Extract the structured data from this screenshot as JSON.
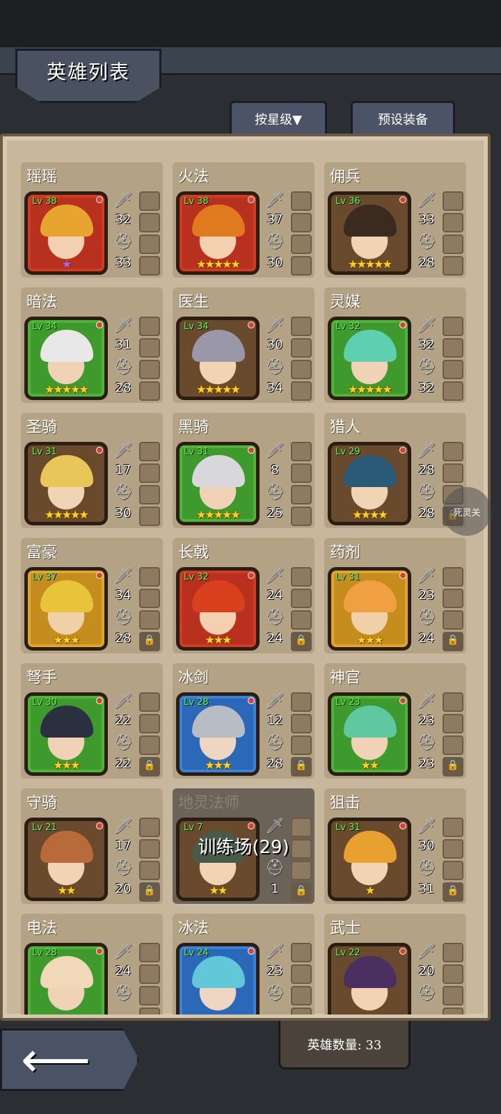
{
  "header": {
    "title": "英雄列表",
    "sort_button": "按星级▼",
    "preset_button": "预设装备"
  },
  "side_float_label": "死灵关",
  "hero_count_label": "英雄数量: 33",
  "heroes": [
    {
      "name": "瑶瑶",
      "level": "Lv 38",
      "frame": "red",
      "hair": "#e7a42e",
      "attack": "32",
      "defense": "33",
      "stars": "★",
      "star_color": "purple",
      "locks": 0,
      "dim": false
    },
    {
      "name": "火法",
      "level": "Lv 38",
      "frame": "red",
      "hair": "#e07a1e",
      "attack": "37",
      "defense": "30",
      "stars": "★★★★★",
      "star_color": "gold",
      "locks": 0,
      "dim": false
    },
    {
      "name": "佣兵",
      "level": "Lv 36",
      "frame": "plain",
      "hair": "#3a2a20",
      "attack": "33",
      "defense": "28",
      "stars": "★★★★★",
      "star_color": "gold",
      "locks": 0,
      "dim": false
    },
    {
      "name": "暗法",
      "level": "Lv 34",
      "frame": "green",
      "hair": "#e8e8e8",
      "attack": "31",
      "defense": "28",
      "stars": "★★★★★",
      "star_color": "gold",
      "locks": 0,
      "dim": false
    },
    {
      "name": "医生",
      "level": "Lv 34",
      "frame": "plain",
      "hair": "#9a98a8",
      "attack": "30",
      "defense": "34",
      "stars": "★★★★★",
      "star_color": "gold",
      "locks": 0,
      "dim": false
    },
    {
      "name": "灵媒",
      "level": "Lv 32",
      "frame": "green",
      "hair": "#5ed0b0",
      "attack": "32",
      "defense": "32",
      "stars": "★★★★★",
      "star_color": "gold",
      "locks": 0,
      "dim": false
    },
    {
      "name": "圣骑",
      "level": "Lv 31",
      "frame": "plain",
      "hair": "#e8c65a",
      "attack": "17",
      "defense": "30",
      "stars": "★★★★★",
      "star_color": "gold",
      "locks": 0,
      "dim": false
    },
    {
      "name": "黑骑",
      "level": "Lv 31",
      "frame": "green",
      "hair": "#d8d8dc",
      "attack": "8",
      "defense": "25",
      "stars": "★★★★★",
      "star_color": "gold",
      "locks": 0,
      "dim": false
    },
    {
      "name": "猎人",
      "level": "Lv 29",
      "frame": "plain",
      "hair": "#2b5a78",
      "attack": "28",
      "defense": "28",
      "stars": "★★★★",
      "star_color": "gold",
      "locks": 1,
      "dim": false
    },
    {
      "name": "富豪",
      "level": "Lv 37",
      "frame": "gold",
      "hair": "#e8c43a",
      "attack": "34",
      "defense": "28",
      "stars": "★★★",
      "star_color": "gold",
      "locks": 1,
      "dim": false
    },
    {
      "name": "长戟",
      "level": "Lv 32",
      "frame": "red",
      "hair": "#d8401e",
      "attack": "24",
      "defense": "24",
      "stars": "★★★",
      "star_color": "gold",
      "locks": 1,
      "dim": false
    },
    {
      "name": "药剂",
      "level": "Lv 31",
      "frame": "gold",
      "hair": "#f0a040",
      "attack": "23",
      "defense": "24",
      "stars": "★★★",
      "star_color": "gold",
      "locks": 1,
      "dim": false
    },
    {
      "name": "弩手",
      "level": "Lv 30",
      "frame": "green",
      "hair": "#2a3040",
      "attack": "22",
      "defense": "22",
      "stars": "★★★",
      "star_color": "gold",
      "locks": 1,
      "dim": false
    },
    {
      "name": "冰剑",
      "level": "Lv 28",
      "frame": "blue",
      "hair": "#b8bcc4",
      "attack": "12",
      "defense": "28",
      "stars": "★★★",
      "star_color": "gold",
      "locks": 1,
      "dim": false
    },
    {
      "name": "神官",
      "level": "Lv 23",
      "frame": "green",
      "hair": "#60c8a0",
      "attack": "23",
      "defense": "23",
      "stars": "★★",
      "star_color": "gold",
      "locks": 1,
      "dim": false
    },
    {
      "name": "守骑",
      "level": "Lv 21",
      "frame": "plain",
      "hair": "#b86a3a",
      "attack": "17",
      "defense": "20",
      "stars": "★★",
      "star_color": "gold",
      "locks": 1,
      "dim": false
    },
    {
      "name": "地灵法师",
      "level": "Lv 7",
      "frame": "plain",
      "hair": "#4a5a48",
      "attack": "",
      "defense": "1",
      "stars": "★★",
      "star_color": "gold",
      "locks": 1,
      "dim": true,
      "overlay": "训练场(29)"
    },
    {
      "name": "狙击",
      "level": "Lv 31",
      "frame": "plain",
      "hair": "#e8a030",
      "attack": "30",
      "defense": "31",
      "stars": "★",
      "star_color": "gold",
      "locks": 1,
      "dim": false
    },
    {
      "name": "电法",
      "level": "Lv 28",
      "frame": "green",
      "hair": "#f0d8b8",
      "attack": "24",
      "defense": "",
      "stars": "",
      "star_color": "gold",
      "locks": 0,
      "dim": false
    },
    {
      "name": "冰法",
      "level": "Lv 24",
      "frame": "blue",
      "hair": "#60c8d8",
      "attack": "23",
      "defense": "",
      "stars": "",
      "star_color": "gold",
      "locks": 0,
      "dim": false
    },
    {
      "name": "武士",
      "level": "Lv 22",
      "frame": "plain",
      "hair": "#4a3060",
      "attack": "20",
      "defense": "",
      "stars": "",
      "star_color": "gold",
      "locks": 0,
      "dim": false
    }
  ]
}
